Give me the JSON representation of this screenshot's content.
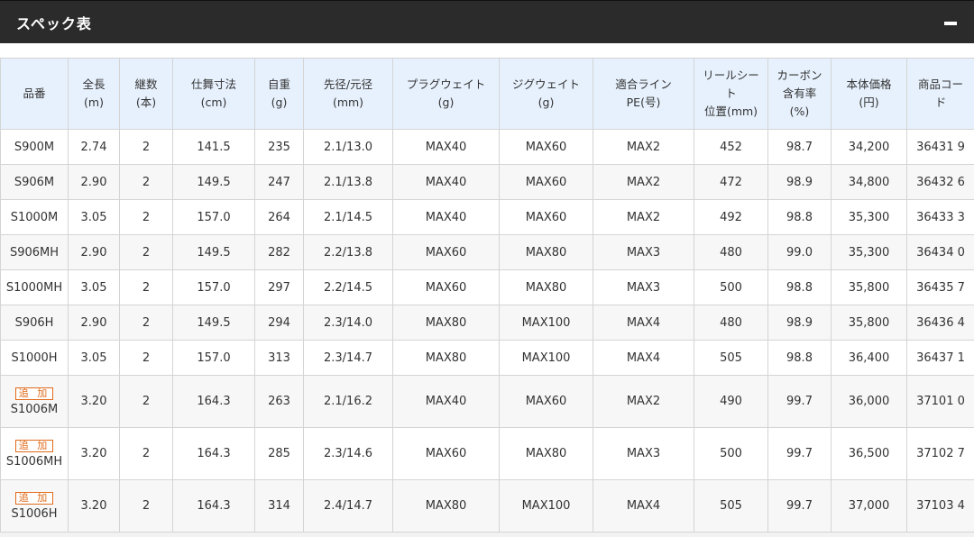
{
  "header": {
    "title": "スペック表",
    "collapse_icon": "minus-icon"
  },
  "table": {
    "headers": [
      [
        "品番"
      ],
      [
        "全長",
        "(m)"
      ],
      [
        "継数",
        "(本)"
      ],
      [
        "仕舞寸法",
        "(cm)"
      ],
      [
        "自重",
        "(g)"
      ],
      [
        "先径/元径",
        "(mm)"
      ],
      [
        "プラグウェイト",
        "(g)"
      ],
      [
        "ジグウェイト",
        "(g)"
      ],
      [
        "適合ライン",
        "PE(号)"
      ],
      [
        "リールシー",
        "ト",
        "位置(mm)"
      ],
      [
        "カーボン",
        "含有率",
        "(%)"
      ],
      [
        "本体価格",
        "(円)"
      ],
      [
        "商品コー",
        "ド"
      ]
    ],
    "rows": [
      {
        "badge": "",
        "model": "S900M",
        "length": "2.74",
        "pieces": "2",
        "closed": "141.5",
        "weight": "235",
        "tip": "2.1/13.0",
        "plug": "MAX40",
        "jig": "MAX60",
        "line": "MAX2",
        "reel": "452",
        "carbon": "98.7",
        "price": "34,200",
        "code": "36431 9"
      },
      {
        "badge": "",
        "model": "S906M",
        "length": "2.90",
        "pieces": "2",
        "closed": "149.5",
        "weight": "247",
        "tip": "2.1/13.8",
        "plug": "MAX40",
        "jig": "MAX60",
        "line": "MAX2",
        "reel": "472",
        "carbon": "98.9",
        "price": "34,800",
        "code": "36432 6"
      },
      {
        "badge": "",
        "model": "S1000M",
        "length": "3.05",
        "pieces": "2",
        "closed": "157.0",
        "weight": "264",
        "tip": "2.1/14.5",
        "plug": "MAX40",
        "jig": "MAX60",
        "line": "MAX2",
        "reel": "492",
        "carbon": "98.8",
        "price": "35,300",
        "code": "36433 3"
      },
      {
        "badge": "",
        "model": "S906MH",
        "length": "2.90",
        "pieces": "2",
        "closed": "149.5",
        "weight": "282",
        "tip": "2.2/13.8",
        "plug": "MAX60",
        "jig": "MAX80",
        "line": "MAX3",
        "reel": "480",
        "carbon": "99.0",
        "price": "35,300",
        "code": "36434 0"
      },
      {
        "badge": "",
        "model": "S1000MH",
        "length": "3.05",
        "pieces": "2",
        "closed": "157.0",
        "weight": "297",
        "tip": "2.2/14.5",
        "plug": "MAX60",
        "jig": "MAX80",
        "line": "MAX3",
        "reel": "500",
        "carbon": "98.8",
        "price": "35,800",
        "code": "36435 7"
      },
      {
        "badge": "",
        "model": "S906H",
        "length": "2.90",
        "pieces": "2",
        "closed": "149.5",
        "weight": "294",
        "tip": "2.3/14.0",
        "plug": "MAX80",
        "jig": "MAX100",
        "line": "MAX4",
        "reel": "480",
        "carbon": "98.9",
        "price": "35,800",
        "code": "36436 4"
      },
      {
        "badge": "",
        "model": "S1000H",
        "length": "3.05",
        "pieces": "2",
        "closed": "157.0",
        "weight": "313",
        "tip": "2.3/14.7",
        "plug": "MAX80",
        "jig": "MAX100",
        "line": "MAX4",
        "reel": "505",
        "carbon": "98.8",
        "price": "36,400",
        "code": "36437 1"
      },
      {
        "badge": "追 加",
        "model": "S1006M",
        "length": "3.20",
        "pieces": "2",
        "closed": "164.3",
        "weight": "263",
        "tip": "2.1/16.2",
        "plug": "MAX40",
        "jig": "MAX60",
        "line": "MAX2",
        "reel": "490",
        "carbon": "99.7",
        "price": "36,000",
        "code": "37101 0"
      },
      {
        "badge": "追 加",
        "model": "S1006MH",
        "length": "3.20",
        "pieces": "2",
        "closed": "164.3",
        "weight": "285",
        "tip": "2.3/14.6",
        "plug": "MAX60",
        "jig": "MAX80",
        "line": "MAX3",
        "reel": "500",
        "carbon": "99.7",
        "price": "36,500",
        "code": "37102 7"
      },
      {
        "badge": "追 加",
        "model": "S1006H",
        "length": "3.20",
        "pieces": "2",
        "closed": "164.3",
        "weight": "314",
        "tip": "2.4/14.7",
        "plug": "MAX80",
        "jig": "MAX100",
        "line": "MAX4",
        "reel": "505",
        "carbon": "99.7",
        "price": "37,000",
        "code": "37103 4"
      }
    ]
  },
  "colors": {
    "header_bg": "#2b2b2b",
    "th_bg": "#e7f1fd",
    "badge": "#e06a1a"
  }
}
